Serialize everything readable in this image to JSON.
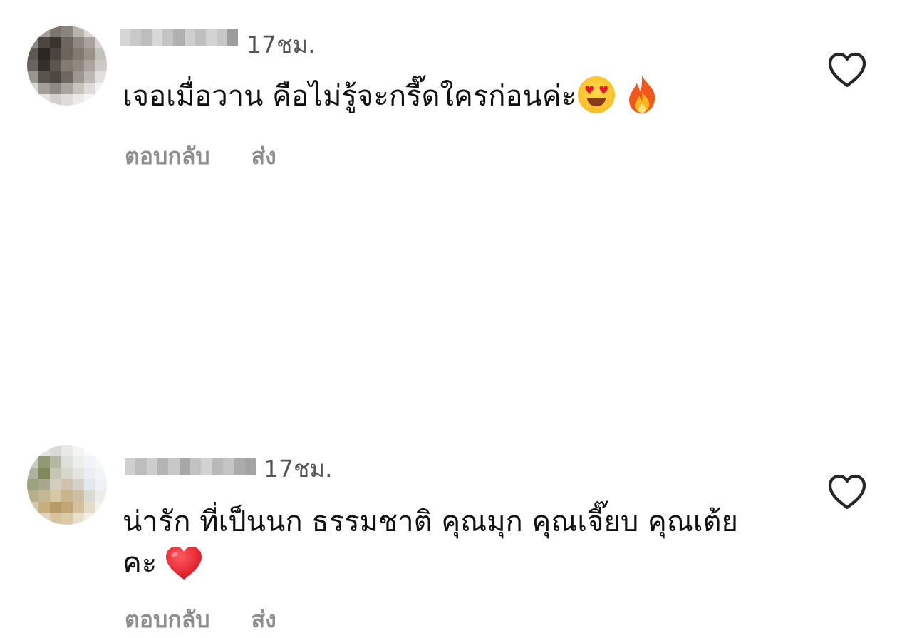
{
  "comments": [
    {
      "time": "17ชม.",
      "text": "เจอเมื่อวาน คือไม่รู้จะกรี๊ดใครก่อนค่ะ",
      "emojis": [
        "smiling-face-with-heart-eyes",
        "fire"
      ],
      "reply_label": "ตอบกลับ",
      "send_label": "ส่ง",
      "like_icon": "heart-outline-icon"
    },
    {
      "time": "17ชม.",
      "text": "น่ารัก ที่เป็นนก ธรรมชาติ คุณมุก คุณเจี๊ยบ คุณเต้ย คะ",
      "emojis": [
        "red-heart"
      ],
      "reply_label": "ตอบกลับ",
      "send_label": "ส่ง",
      "like_icon": "heart-outline-icon"
    }
  ],
  "colors": {
    "text": "#111111",
    "meta": "#555555",
    "action": "#8e8e8e",
    "heart": "#e0202e"
  }
}
